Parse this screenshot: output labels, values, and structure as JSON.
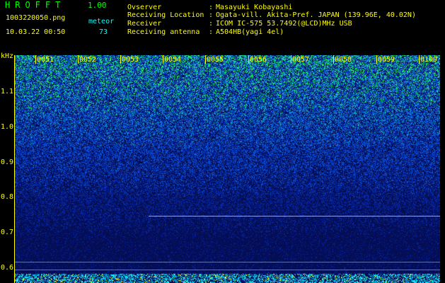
{
  "header": {
    "app_title": "HROFFT",
    "version": "1.00",
    "file_name": "1003220050.png",
    "meteor_label": "meteor",
    "datetime": "10.03.22 00:50",
    "meteor_count": "73"
  },
  "meta": [
    {
      "key": "Ovserver",
      "sep": ":",
      "value": "Masayuki Kobayashi"
    },
    {
      "key": "Receiving Location",
      "sep": ":",
      "value": "Ogata-vill. Akita-Pref. JAPAN (139.96E, 40.02N)"
    },
    {
      "key": "Receiver",
      "sep": ":",
      "value": "ICOM IC-575 53.7492(@LCD)MHz USB"
    },
    {
      "key": "Receiving antenna",
      "sep": ":",
      "value": "A504HB(yagi 4el)"
    }
  ],
  "axis": {
    "y_unit": "kHz",
    "y_ticks": [
      "1.1",
      "1.0",
      "0.9",
      "0.8",
      "0.7",
      "0.6"
    ],
    "x_ticks": [
      "0051",
      "0052",
      "0053",
      "0054",
      "0055",
      "0056",
      "0057",
      "0058",
      "0059",
      "0100"
    ]
  },
  "colors": {
    "text_green": "#00ff00",
    "text_yellow": "#ffff00",
    "text_cyan": "#00ffff",
    "background": "#000000"
  }
}
